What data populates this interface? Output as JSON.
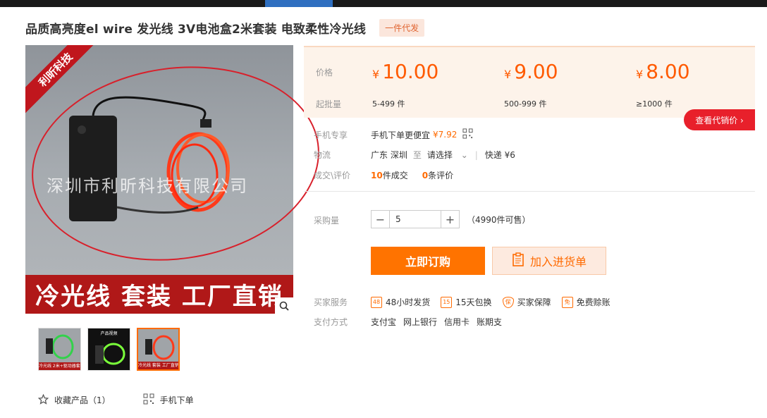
{
  "product": {
    "title": "品质高亮度el wire 发光线 3V电池盒2米套装 电致柔性冷光线",
    "badge": "一件代发"
  },
  "image": {
    "corner_label": "利昕科技",
    "watermark": "深圳市利昕科技有限公司",
    "banner": "冷光线 套装 工厂直销"
  },
  "thumbnails": [
    {
      "caption": "冷光线 2米+驱动器套装"
    },
    {
      "caption": "产品视频"
    },
    {
      "caption": "冷光线 套装 工厂直销"
    }
  ],
  "price": {
    "price_label": "价格",
    "moq_label": "起批量",
    "currency": "¥",
    "tiers": [
      {
        "price": "10.00",
        "moq": "5-499 件"
      },
      {
        "price": "9.00",
        "moq": "500-999 件"
      },
      {
        "price": "8.00",
        "moq": "≥1000 件"
      }
    ],
    "agent_button": "查看代销价 ›"
  },
  "mobile": {
    "label": "手机专享",
    "text": "手机下单更便宜",
    "price": "¥7.92"
  },
  "logistics": {
    "label": "物流",
    "origin": "广东 深圳",
    "to": "至",
    "select": "请选择",
    "express": "快递 ¥6"
  },
  "reviews": {
    "label": "成交\\评价",
    "deals_count": "10",
    "deals_text": "件成交",
    "reviews_count": "0",
    "reviews_text": "条评价"
  },
  "quantity": {
    "label": "采购量",
    "value": "5",
    "stock": "（4990件可售）"
  },
  "buttons": {
    "buy": "立即订购",
    "cart": "加入进货单"
  },
  "services": {
    "label": "买家服务",
    "items": [
      {
        "icon": "48h-icon",
        "glyph": "48",
        "text": "48小时发货"
      },
      {
        "icon": "return-15-icon",
        "glyph": "15",
        "text": "15天包换"
      },
      {
        "icon": "shield-icon",
        "glyph": "保",
        "text": "买家保障"
      },
      {
        "icon": "fee-icon",
        "glyph": "免",
        "text": "免费赊账"
      }
    ]
  },
  "payment": {
    "label": "支付方式",
    "methods": [
      "支付宝",
      "网上银行",
      "信用卡",
      "账期支"
    ]
  },
  "actions": {
    "favorite": "收藏产品（1）",
    "mobile_order": "手机下单"
  }
}
